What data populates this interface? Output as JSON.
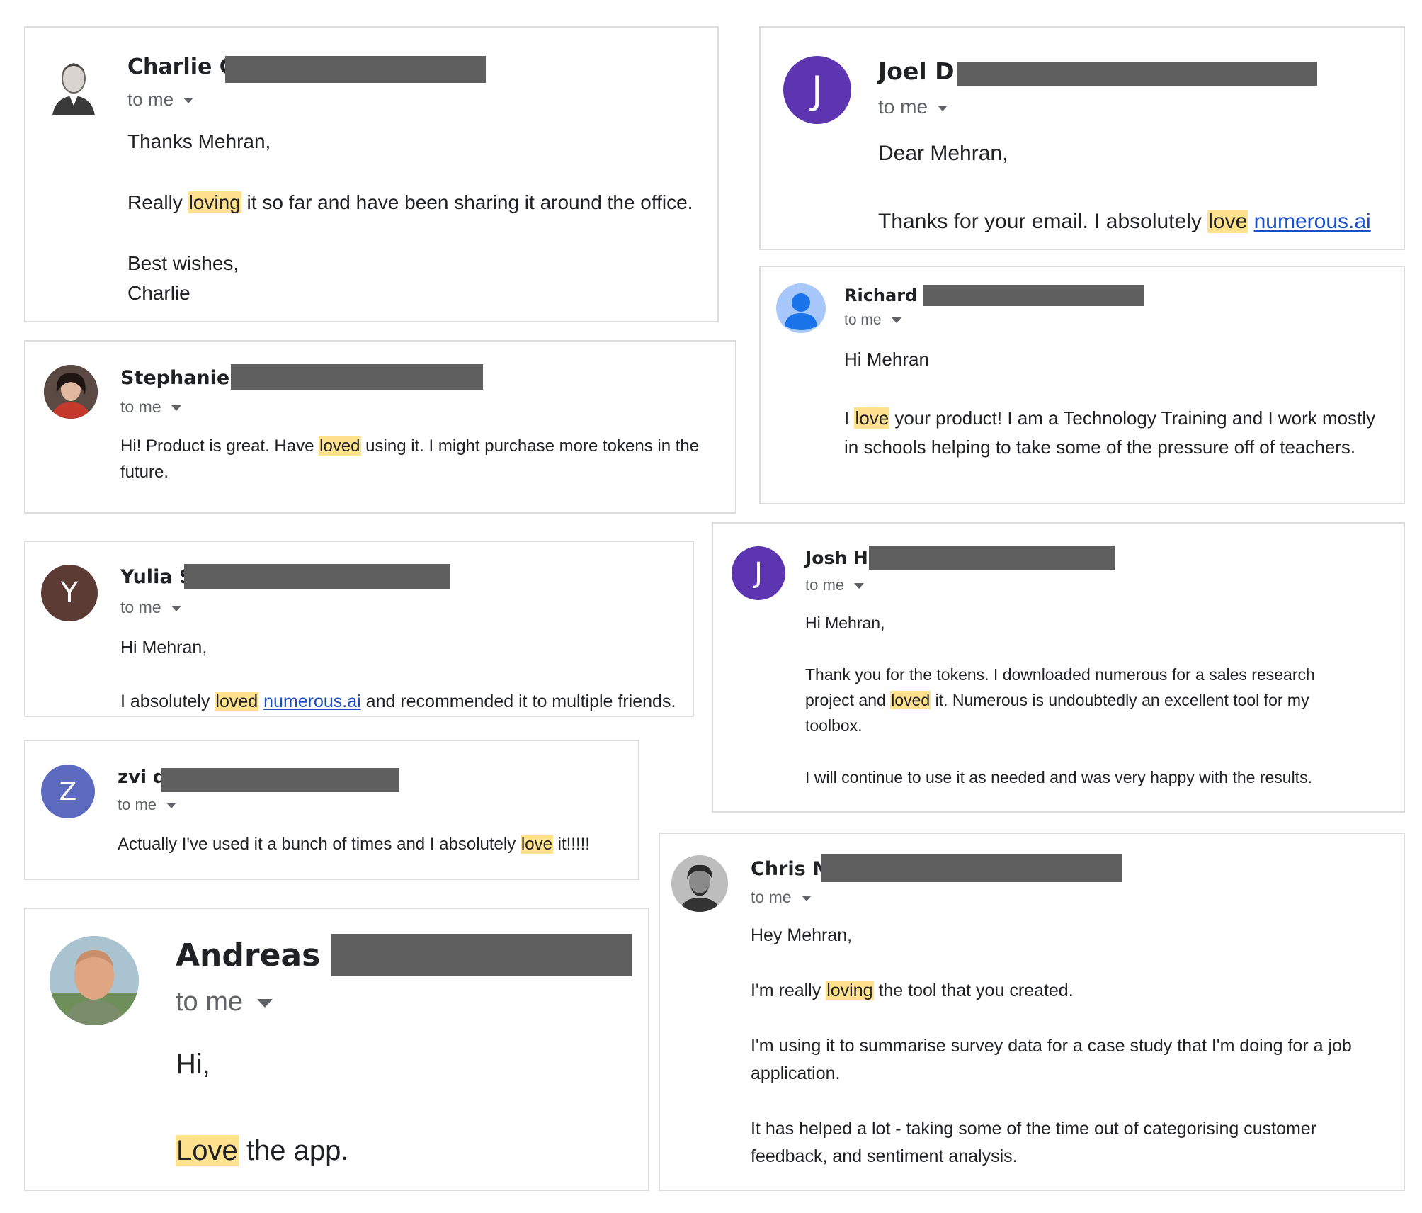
{
  "emails": {
    "charlie": {
      "name": "Charlie C",
      "to": "to me",
      "greeting": "Thanks Mehran,",
      "line_pre": "Really ",
      "highlight": "loving",
      "line_post": " it so far and have been sharing it around the office.",
      "signoff1": "Best wishes,",
      "signoff2": "Charlie"
    },
    "joel": {
      "initial": "J",
      "avatar_color": "#5e35b1",
      "name": "Joel D",
      "to": "to me",
      "greeting": "Dear Mehran,",
      "line_pre": "Thanks for your email. I absolutely ",
      "highlight": "love",
      "link": "numerous.ai"
    },
    "stephanie": {
      "name": "Stephanie B",
      "to": "to me",
      "line_pre": "Hi!  Product is great. Have ",
      "highlight": "loved",
      "line_post": " using it. I might purchase more tokens in the future."
    },
    "richard": {
      "avatar_color": "#a8c7fa",
      "name": "Richard C",
      "to": "to me",
      "greeting": "Hi Mehran",
      "line_pre": "I ",
      "highlight": "love",
      "line_post": " your product! I am a Technology Training and I work mostly in schools helping to take some of the pressure off of teachers."
    },
    "yulia": {
      "initial": "Y",
      "avatar_color": "#5d3b35",
      "name": "Yulia S",
      "to": "to me",
      "greeting": "Hi Mehran,",
      "line_pre": "I absolutely ",
      "highlight": "loved",
      "link": "numerous.ai",
      "line_post": " and recommended it to multiple friends."
    },
    "josh": {
      "initial": "J",
      "avatar_color": "#5e35b1",
      "name": "Josh H",
      "to": "to me",
      "greeting": "Hi Mehran,",
      "line_pre": "Thank you for the tokens. I downloaded numerous for a sales research project and ",
      "highlight": "loved",
      "line_post": " it. Numerous is undoubtedly an excellent tool for my toolbox.",
      "line2": "I will continue to use it as needed and was very happy with the results."
    },
    "zvi": {
      "initial": "Z",
      "avatar_color": "#5c6bc0",
      "name": "zvi d",
      "to": "to me",
      "line_pre": "Actually I've used it a bunch of times and I absolutely ",
      "highlight": "love",
      "line_post": " it!!!!!"
    },
    "chris": {
      "name": "Chris M",
      "to": "to me",
      "greeting": "Hey Mehran,",
      "line_pre": "I'm really ",
      "highlight": "loving",
      "line_post": " the tool that you created.",
      "line2": "I'm using it to summarise survey data for a case study that I'm doing for a job application.",
      "line3": "It has helped a lot - taking some of the time out of categorising customer feedback, and sentiment analysis."
    },
    "andreas": {
      "name": "Andreas S",
      "to": "to me",
      "greeting": "Hi,",
      "highlight": "Love",
      "line_post": " the app."
    }
  },
  "colors": {
    "highlight": "#ffe18e",
    "link": "#1a4fc4",
    "redaction": "#5f5f5f",
    "border": "#dadce0"
  }
}
